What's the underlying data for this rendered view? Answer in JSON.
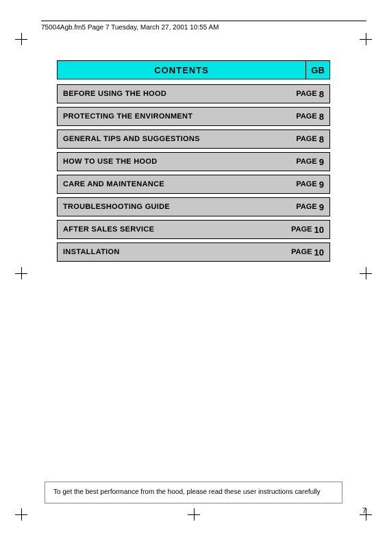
{
  "header": {
    "text": "75004Agb.fm5  Page 7  Tuesday, March 27, 2001  10:55 AM"
  },
  "contents": {
    "title": "CONTENTS",
    "gb_label": "GB",
    "rows": [
      {
        "label": "BEFORE USING THE HOOD",
        "page_label": "PAGE",
        "page_num": "8"
      },
      {
        "label": "PROTECTING THE ENVIRONMENT",
        "page_label": "PAGE",
        "page_num": "8"
      },
      {
        "label": "GENERAL TIPS AND SUGGESTIONS",
        "page_label": "PAGE",
        "page_num": "8"
      },
      {
        "label": "HOW TO USE THE HOOD",
        "page_label": "PAGE",
        "page_num": "9"
      },
      {
        "label": "CARE AND MAINTENANCE",
        "page_label": "PAGE",
        "page_num": "9"
      },
      {
        "label": "TROUBLESHOOTING GUIDE",
        "page_label": "PAGE",
        "page_num": "9"
      },
      {
        "label": "AFTER SALES SERVICE",
        "page_label": "PAGE",
        "page_num": "10"
      },
      {
        "label": "INSTALLATION",
        "page_label": "PAGE",
        "page_num": "10"
      }
    ]
  },
  "bottom_note": "To get the best performance from the hood, please read these user instructions carefully",
  "page_number": "7"
}
